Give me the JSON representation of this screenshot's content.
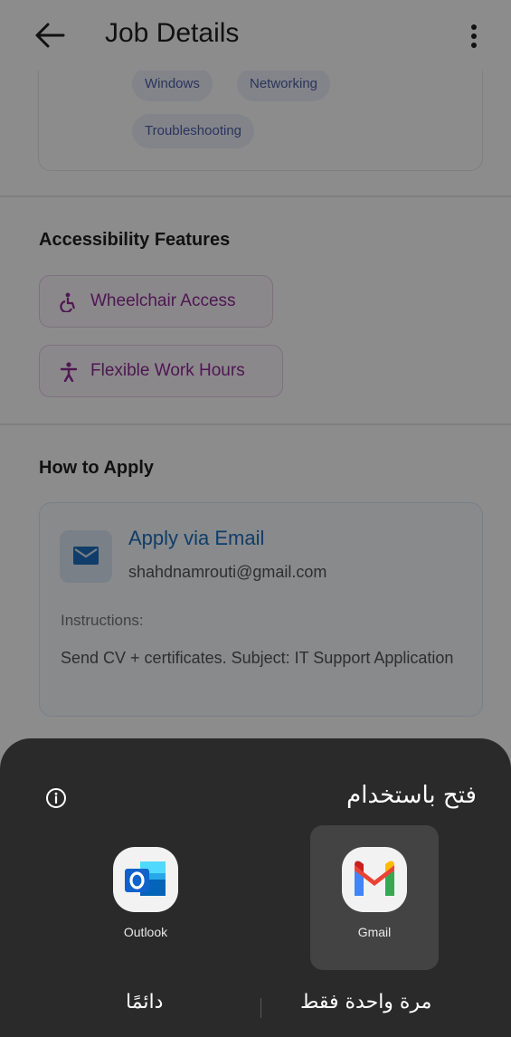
{
  "header": {
    "title": "Job Details"
  },
  "skills": [
    "Windows",
    "Networking",
    "Troubleshooting"
  ],
  "accessibility": {
    "title": "Accessibility Features",
    "items": [
      {
        "label": "Wheelchair Access",
        "icon": "wheelchair-icon"
      },
      {
        "label": "Flexible Work Hours",
        "icon": "person-icon"
      }
    ]
  },
  "apply": {
    "section_title": "How to Apply",
    "method_title": "Apply via Email",
    "email": "shahdnamrouti@gmail.com",
    "instructions_label": "Instructions:",
    "instructions_text": "Send CV + certificates. Subject: IT Support Application"
  },
  "chooser": {
    "title": "فتح باستخدام",
    "apps": [
      {
        "label": "Outlook",
        "icon": "outlook-icon"
      },
      {
        "label": "Gmail",
        "icon": "gmail-icon",
        "selected": true
      }
    ],
    "always_label": "دائمًا",
    "once_label": "مرة واحدة فقط"
  },
  "colors": {
    "accent_purple": "#8e2a97",
    "accent_blue": "#1e6fbf",
    "sheet_bg": "#2a2a2a"
  }
}
